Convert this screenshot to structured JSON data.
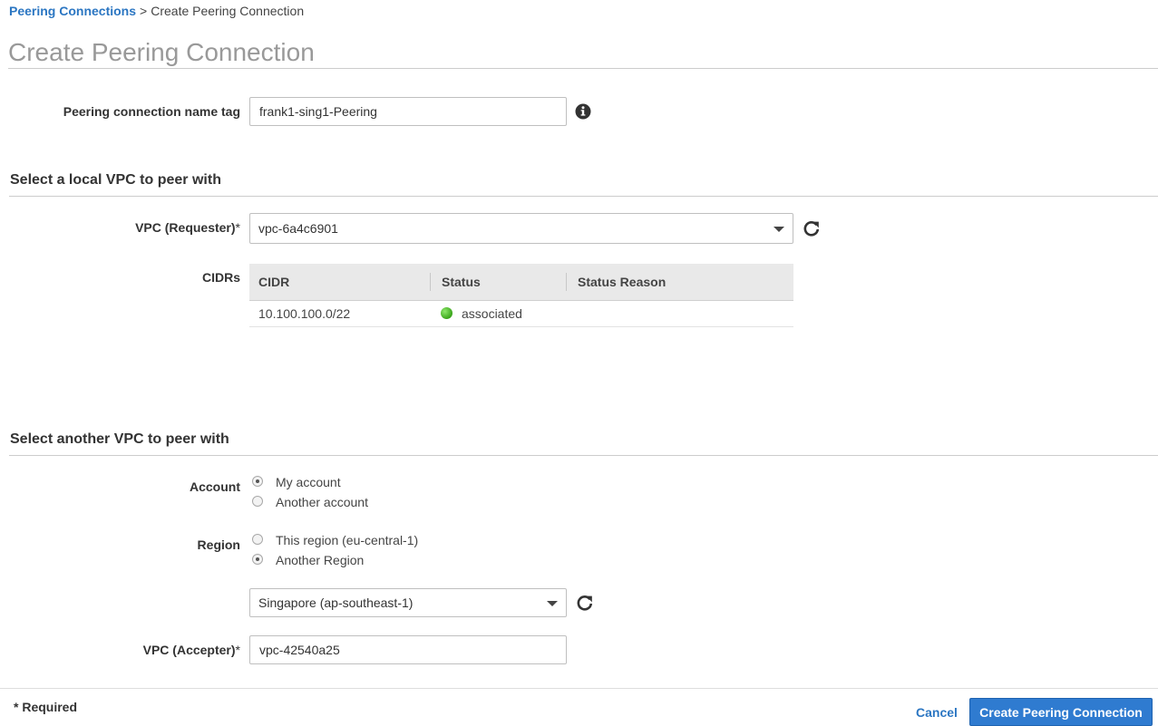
{
  "breadcrumb": {
    "parent": "Peering Connections",
    "separator": ">",
    "current": "Create Peering Connection"
  },
  "page_title": "Create Peering Connection",
  "name_tag": {
    "label": "Peering connection name tag",
    "value": "frank1-sing1-Peering",
    "icon": "info-icon"
  },
  "local_section": {
    "title": "Select a local VPC to peer with",
    "vpc_label": "VPC (Requester)",
    "vpc_value": "vpc-6a4c6901",
    "cidrs_label": "CIDRs",
    "table": {
      "headers": [
        "CIDR",
        "Status",
        "Status Reason"
      ],
      "rows": [
        {
          "cidr": "10.100.100.0/22",
          "status": "associated",
          "status_reason": ""
        }
      ]
    }
  },
  "remote_section": {
    "title": "Select another VPC to peer with",
    "account_label": "Account",
    "account_options": [
      "My account",
      "Another account"
    ],
    "account_selected": "My account",
    "region_label": "Region",
    "region_options": [
      "This region (eu-central-1)",
      "Another Region"
    ],
    "region_selected": "Another Region",
    "region_select_value": "Singapore (ap-southeast-1)",
    "vpc_label": "VPC (Accepter)",
    "vpc_value": "vpc-42540a25"
  },
  "footer": {
    "required_note": "Required",
    "cancel_label": "Cancel",
    "create_label": "Create Peering Connection"
  },
  "colors": {
    "link": "#2b76c2",
    "primary_button": "#2f7bd0",
    "title_gray": "#999999",
    "status_ok": "#3aa51a"
  }
}
